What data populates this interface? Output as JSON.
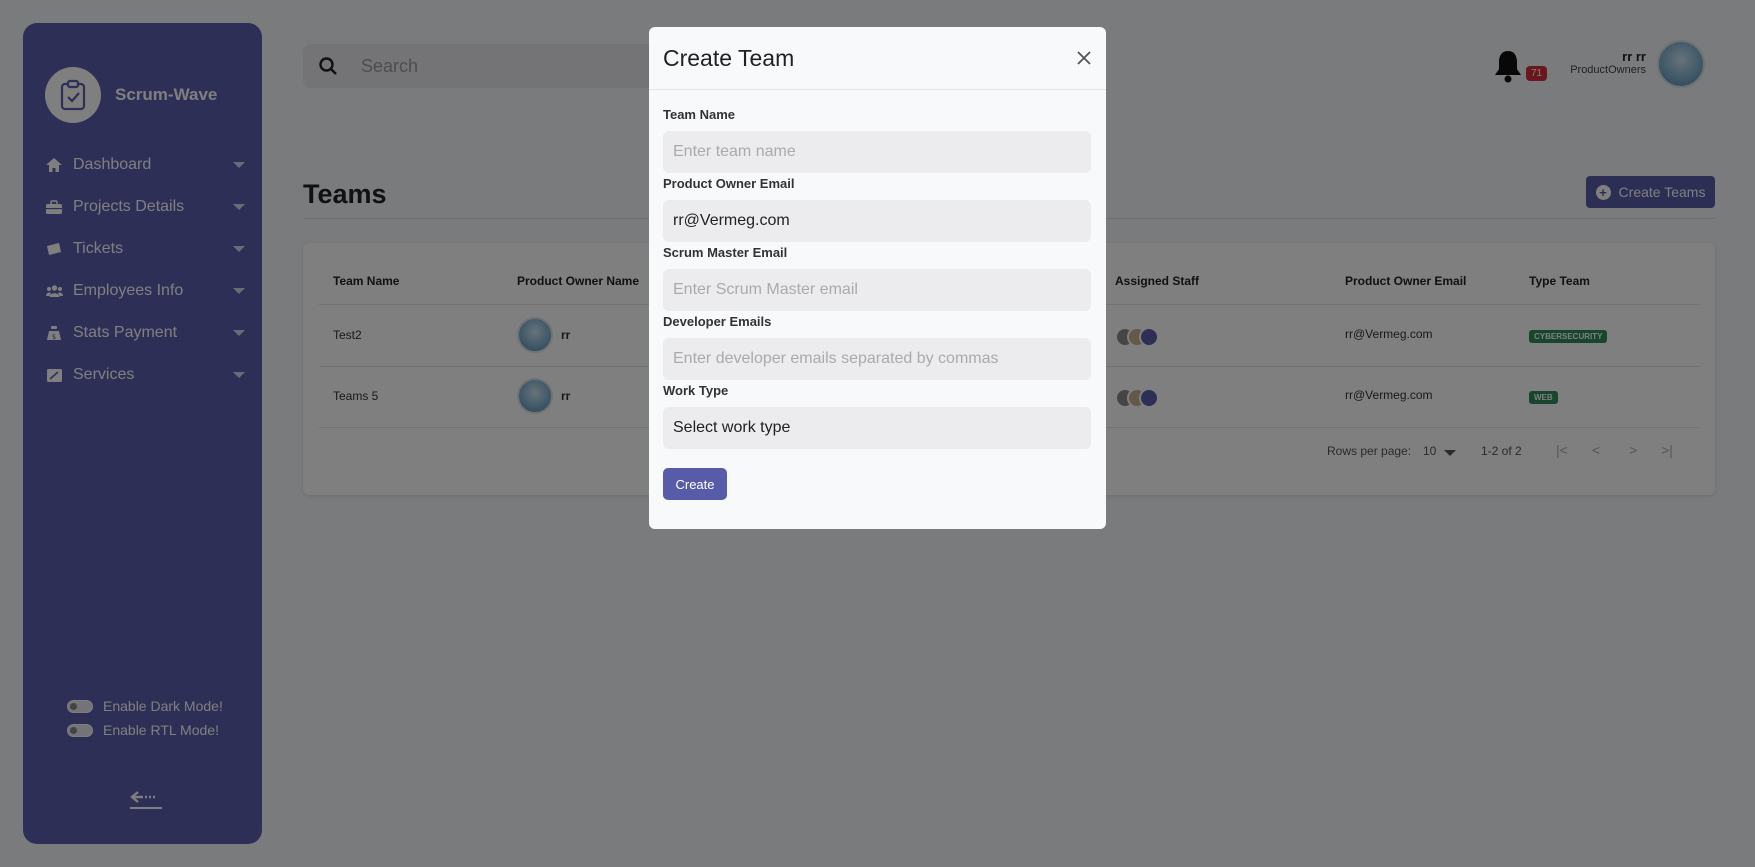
{
  "brand": {
    "name": "Scrum-Wave",
    "logo_icon": "clipboard-check-icon"
  },
  "sidebar": {
    "items": [
      {
        "label": "Dashboard",
        "icon": "home-icon"
      },
      {
        "label": "Projects Details",
        "icon": "briefcase-icon"
      },
      {
        "label": "Tickets",
        "icon": "ticket-icon"
      },
      {
        "label": "Employees Info",
        "icon": "users-icon"
      },
      {
        "label": "Stats Payment",
        "icon": "money-bag-icon"
      },
      {
        "label": "Services",
        "icon": "window-icon"
      }
    ],
    "toggles": [
      {
        "label": "Enable Dark Mode!"
      },
      {
        "label": "Enable RTL Mode!"
      }
    ]
  },
  "topbar": {
    "search_placeholder": "Search",
    "notifications_count": "71",
    "user_name": "rr rr",
    "user_role": "ProductOwners"
  },
  "page": {
    "title": "Teams",
    "create_button": "Create Teams"
  },
  "table": {
    "headers": {
      "team_name": "Team Name",
      "product_owner_name": "Product Owner Name",
      "assigned_staff": "Assigned Staff",
      "product_owner_email": "Product Owner Email",
      "type_team": "Type Team"
    },
    "rows": [
      {
        "team_name": "Test2",
        "owner": "rr",
        "email": "rr@Vermeg.com",
        "type": "CYBERSECURITY"
      },
      {
        "team_name": "Teams 5",
        "owner": "rr",
        "email": "rr@Vermeg.com",
        "type": "WEB"
      }
    ],
    "pagination": {
      "rows_per_page_label": "Rows per page:",
      "rows_per_page": "10",
      "range": "1-2 of 2"
    }
  },
  "modal": {
    "title": "Create Team",
    "fields": {
      "team_name": {
        "label": "Team Name",
        "placeholder": "Enter team name",
        "value": ""
      },
      "product_owner_email": {
        "label": "Product Owner Email",
        "value": "rr@Vermeg.com"
      },
      "scrum_master_email": {
        "label": "Scrum Master Email",
        "placeholder": "Enter Scrum Master email",
        "value": ""
      },
      "developer_emails": {
        "label": "Developer Emails",
        "placeholder": "Enter developer emails separated by commas",
        "value": ""
      },
      "work_type": {
        "label": "Work Type",
        "value": "Select work type"
      }
    },
    "submit_label": "Create"
  },
  "colors": {
    "sidebar": "#5a5fad",
    "primary_button": "#585ca8",
    "badge_red": "#d42c3a",
    "type_green": "#2e8a5a"
  }
}
